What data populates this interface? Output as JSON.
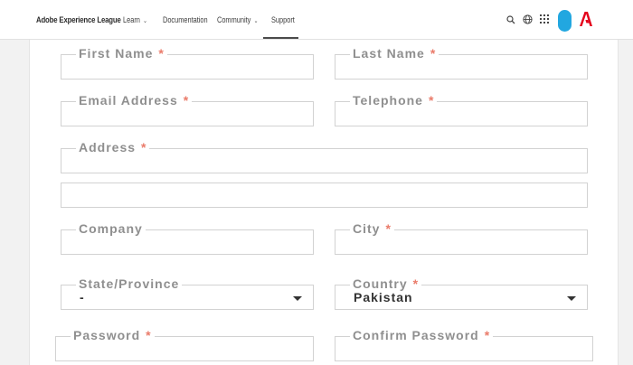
{
  "nav": {
    "brand": "Adobe Experience League",
    "items": [
      {
        "label": "Learn",
        "has_dropdown": true
      },
      {
        "label": "Documentation",
        "has_dropdown": false
      },
      {
        "label": "Community",
        "has_dropdown": true
      },
      {
        "label": "Support",
        "has_dropdown": false,
        "active": true
      }
    ],
    "icons": [
      "search-icon",
      "globe-icon",
      "apps-grid-icon",
      "avatar",
      "adobe-logo"
    ],
    "avatar_color": "#22a7e0",
    "logo_color": "#e4001b"
  },
  "form": {
    "required_marker": "*",
    "fields": {
      "first_name": {
        "label": "First Name",
        "required": true,
        "value": ""
      },
      "last_name": {
        "label": "Last Name",
        "required": true,
        "value": ""
      },
      "email": {
        "label": "Email Address",
        "required": true,
        "value": ""
      },
      "telephone": {
        "label": "Telephone",
        "required": true,
        "value": ""
      },
      "address": {
        "label": "Address",
        "required": true,
        "value": ""
      },
      "address2": {
        "label": "",
        "required": false,
        "value": ""
      },
      "company": {
        "label": "Company",
        "required": false,
        "value": ""
      },
      "city": {
        "label": "City",
        "required": true,
        "value": ""
      },
      "state": {
        "label": "State/Province",
        "required": false,
        "value": "-"
      },
      "country": {
        "label": "Country",
        "required": true,
        "value": "Pakistan"
      },
      "password": {
        "label": "Password",
        "required": true,
        "value": ""
      },
      "confirm_password": {
        "label": "Confirm Password",
        "required": true,
        "value": ""
      }
    }
  }
}
